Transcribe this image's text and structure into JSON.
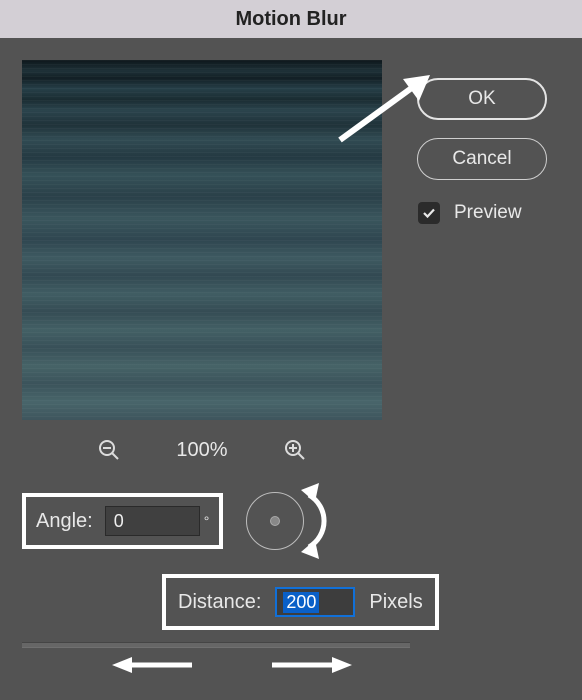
{
  "title": "Motion Blur",
  "buttons": {
    "ok": "OK",
    "cancel": "Cancel"
  },
  "preview_label": "Preview",
  "preview_checked": true,
  "zoom": "100%",
  "angle": {
    "label": "Angle:",
    "value": "0",
    "unit": "°"
  },
  "distance": {
    "label": "Distance:",
    "value": "200",
    "unit": "Pixels"
  },
  "icons": {
    "zoom_out": "zoom-out",
    "zoom_in": "zoom-in",
    "check": "check"
  }
}
